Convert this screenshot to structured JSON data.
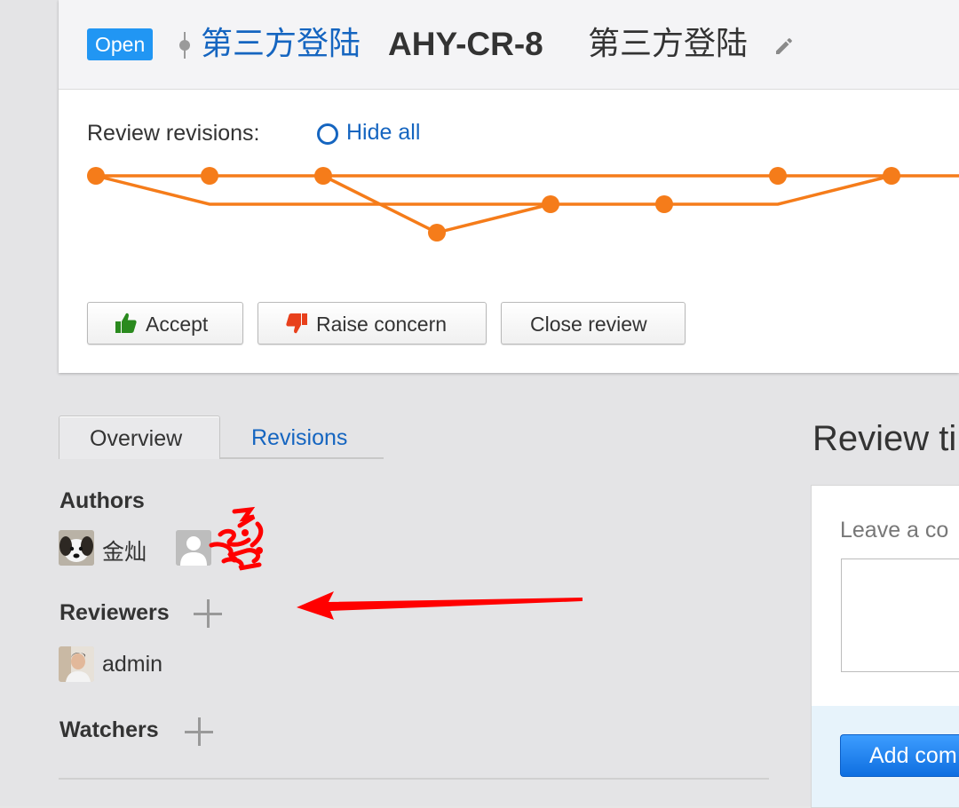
{
  "header": {
    "status_badge": "Open",
    "repo_link": "第三方登陆",
    "review_id": "AHY-CR-8",
    "title": "第三方登陆"
  },
  "revisions": {
    "label": "Review revisions:",
    "hide_all_label": "Hide all",
    "line_color": "#f57c1a"
  },
  "actions": {
    "accept_label": "Accept",
    "raise_concern_label": "Raise concern",
    "close_review_label": "Close review"
  },
  "tabs": {
    "overview_label": "Overview",
    "revisions_label": "Revisions"
  },
  "people": {
    "authors_title": "Authors",
    "authors": [
      {
        "name": "金灿",
        "icon": "dog-avatar"
      },
      {
        "name": "",
        "icon": "default-user-avatar"
      }
    ],
    "reviewers_title": "Reviewers",
    "reviewers": [
      {
        "name": "admin",
        "icon": "person-photo-avatar"
      }
    ],
    "watchers_title": "Watchers"
  },
  "side": {
    "timeline_title": "Review ti",
    "comment_placeholder": "Leave a co",
    "add_comment_label": "Add com"
  },
  "colors": {
    "link": "#1565c0",
    "badge": "#2196f3",
    "accent_orange": "#f57c1a",
    "annotation_red": "#ff0000"
  }
}
